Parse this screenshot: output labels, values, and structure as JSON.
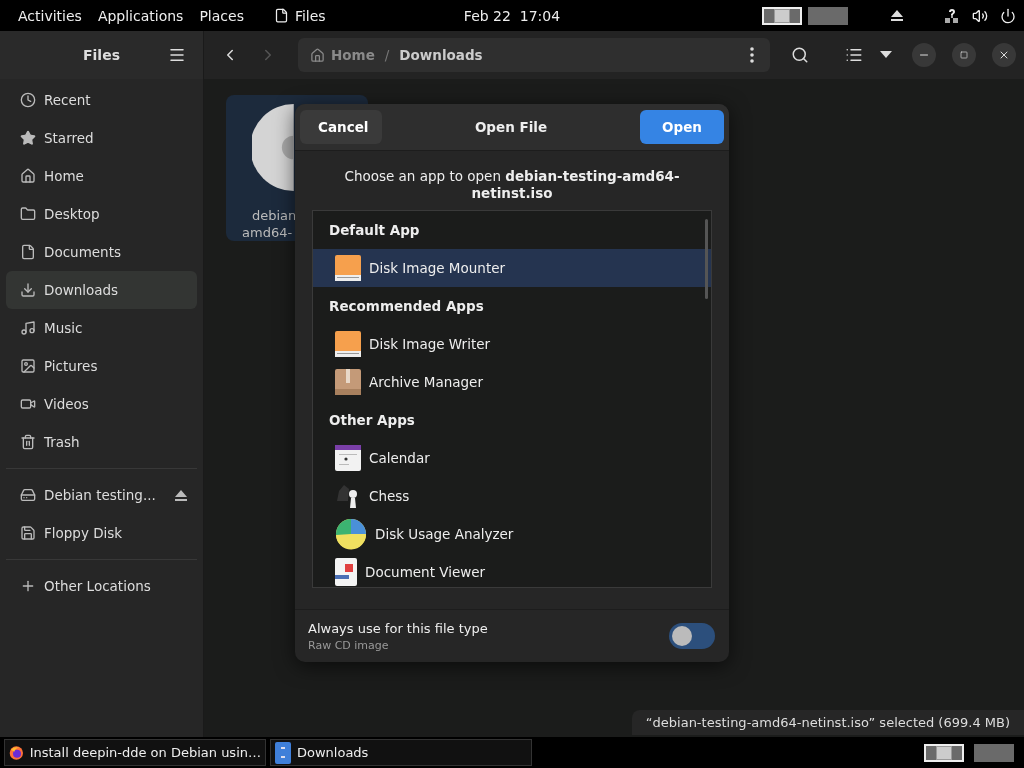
{
  "top_bar": {
    "menus": [
      "Activities",
      "Applications",
      "Places"
    ],
    "app": "Files",
    "clock": "Feb 22  17:04",
    "workspaces": [
      {
        "selected": true
      },
      {
        "selected": false
      }
    ]
  },
  "sidebar": {
    "title": "Files",
    "places": [
      {
        "label": "Recent",
        "kind": "recent",
        "selected": false
      },
      {
        "label": "Starred",
        "kind": "starred",
        "selected": false
      },
      {
        "label": "Home",
        "kind": "home",
        "selected": false
      },
      {
        "label": "Desktop",
        "kind": "folder",
        "selected": false
      },
      {
        "label": "Documents",
        "kind": "document",
        "selected": false
      },
      {
        "label": "Downloads",
        "kind": "download",
        "selected": true
      },
      {
        "label": "Music",
        "kind": "music",
        "selected": false
      },
      {
        "label": "Pictures",
        "kind": "pictures",
        "selected": false
      },
      {
        "label": "Videos",
        "kind": "videos",
        "selected": false
      },
      {
        "label": "Trash",
        "kind": "trash",
        "selected": false
      }
    ],
    "devices": [
      {
        "label": "Debian testing...",
        "kind": "drive",
        "ejectable": true
      },
      {
        "label": "Floppy Disk",
        "kind": "floppy",
        "ejectable": false
      }
    ],
    "other": "Other Locations"
  },
  "path": [
    {
      "label": "Home",
      "selected": false
    },
    {
      "label": "Downloads",
      "selected": true
    }
  ],
  "path_separator": "/",
  "files": [
    {
      "lines": [
        "debian",
        "amd64-"
      ],
      "selected": true
    }
  ],
  "dialog": {
    "cancel": "Cancel",
    "title": "Open File",
    "open": "Open",
    "prompt": "Choose an app to open **debian-testing-amd64-netinst.iso**",
    "sections": [
      {
        "heading": "Default App",
        "apps": [
          {
            "name": "Disk Image Mounter",
            "kind": "disk",
            "selected": true
          }
        ]
      },
      {
        "heading": "Recommended Apps",
        "apps": [
          {
            "name": "Disk Image Writer",
            "kind": "disk",
            "selected": false
          },
          {
            "name": "Archive Manager",
            "kind": "archive",
            "selected": false
          }
        ]
      },
      {
        "heading": "Other Apps",
        "apps": [
          {
            "name": "Calendar",
            "kind": "calendar",
            "selected": false
          },
          {
            "name": "Chess",
            "kind": "chess",
            "selected": false
          },
          {
            "name": "Disk Usage Analyzer",
            "kind": "pie",
            "selected": false
          },
          {
            "name": "Document Viewer",
            "kind": "viewer",
            "selected": false
          }
        ]
      }
    ],
    "always": {
      "label": "Always use for this file type",
      "sublabel": "Raw CD image",
      "on": false
    }
  },
  "status": "“debian-testing-amd64-netinst.iso” selected  (699.4 MB)",
  "taskbar": {
    "windows": [
      {
        "title": "Install deepin-dde on Debian usin…",
        "kind": "browser"
      },
      {
        "title": "Downloads",
        "kind": "files"
      }
    ],
    "workspaces": [
      {
        "selected": true
      },
      {
        "selected": false
      }
    ]
  }
}
